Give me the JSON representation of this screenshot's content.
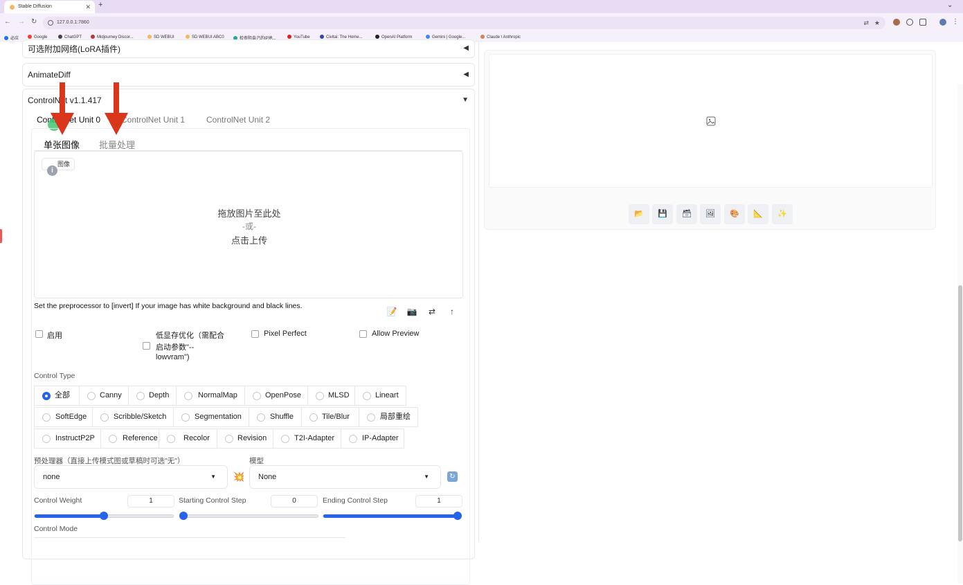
{
  "browser": {
    "tab_title": "Stable Diffusion",
    "url": "127.0.0.1:7860",
    "bookmarks": [
      "必应",
      "Google",
      "ChatGPT",
      "Midjourney Discor...",
      "SD WEBUI",
      "SD WEBUI ABC0",
      "检查阻自己的IP地...",
      "YouTube",
      "Civitai: The Home...",
      "OpenAI Platform",
      "Gemini | Google...",
      "Claude \\ Anthropic"
    ]
  },
  "accordions": {
    "lora": "可选附加网络(LoRA插件)",
    "animatediff": "AnimateDiff",
    "controlnet": "ControlNet v1.1.417"
  },
  "unit_tabs": [
    "ControlNet Unit 0",
    "ControlNet Unit 1",
    "ControlNet Unit 2"
  ],
  "image_tabs": [
    "单张图像",
    "批量处理"
  ],
  "upload": {
    "chip": "图像",
    "line1": "拖放图片至此处",
    "line2": "-或-",
    "line3": "点击上传"
  },
  "hint": "Set the preprocessor to [invert] If your image has white background and black lines.",
  "checkboxes": {
    "enable": "启用",
    "lowvram_1": "低显存优化（需配合",
    "lowvram_2": "启动参数\"--",
    "lowvram_3": "lowvram\")",
    "pixel_perfect": "Pixel Perfect",
    "allow_preview": "Allow Preview"
  },
  "control_type": {
    "label": "Control Type",
    "selected": "全部",
    "rows": [
      [
        "全部",
        "Canny",
        "Depth",
        "NormalMap",
        "OpenPose",
        "MLSD",
        "Lineart"
      ],
      [
        "SoftEdge",
        "Scribble/Sketch",
        "Segmentation",
        "Shuffle",
        "Tile/Blur",
        "局部重绘"
      ],
      [
        "InstructP2P",
        "Reference",
        "Recolor",
        "Revision",
        "T2I-Adapter",
        "IP-Adapter"
      ]
    ]
  },
  "preprocessor": {
    "label": "预处理器（直接上传模式图或草稿时可选\"无\"）",
    "value": "none"
  },
  "model": {
    "label": "模型",
    "value": "None"
  },
  "sliders": {
    "weight": {
      "label": "Control Weight",
      "value": "1",
      "fraction": 0.5
    },
    "start": {
      "label": "Starting Control Step",
      "value": "0",
      "fraction": 0.0
    },
    "end": {
      "label": "Ending Control Step",
      "value": "1",
      "fraction": 1.0
    }
  },
  "control_mode_label": "Control Mode",
  "colors": {
    "accent": "#2563eb",
    "annotation_arrow": "#d9361c"
  },
  "preview_tools": [
    "folder-icon",
    "save-icon",
    "zip-icon",
    "image-icon",
    "palette-icon",
    "ruler-icon",
    "sparkle-icon"
  ]
}
